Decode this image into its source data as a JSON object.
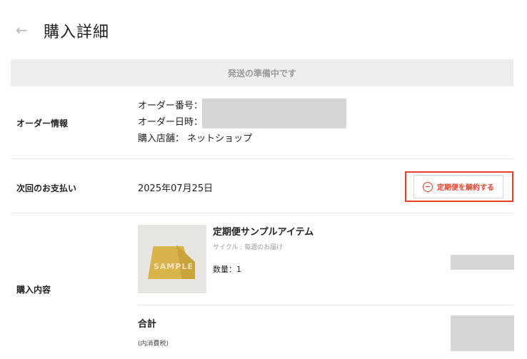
{
  "header": {
    "back_icon": "←",
    "title": "購入詳細"
  },
  "status": {
    "text": "発送の準備中です"
  },
  "order_info": {
    "label": "オーダー情報",
    "order_number_label": "オーダー番号：",
    "order_datetime_label": "オーダー日時：",
    "store_label": "購入店舗：",
    "store_value": "ネットショップ"
  },
  "next_payment": {
    "label": "次回のお支払い",
    "date": "2025年07月25日",
    "cancel_button": "定期便を解約する"
  },
  "purchase": {
    "label": "購入内容",
    "image_watermark": "SAMPLE",
    "item_name": "定期便サンプルアイテム",
    "cycle": "サイクル : 毎週のお届け",
    "quantity_label": "数量：",
    "quantity_value": "1",
    "total_label": "合計",
    "tax_note": "(内消費税)"
  },
  "colors": {
    "accent": "#e8402a",
    "status_bg": "#ededed",
    "redacted": "#d6d6d6"
  }
}
